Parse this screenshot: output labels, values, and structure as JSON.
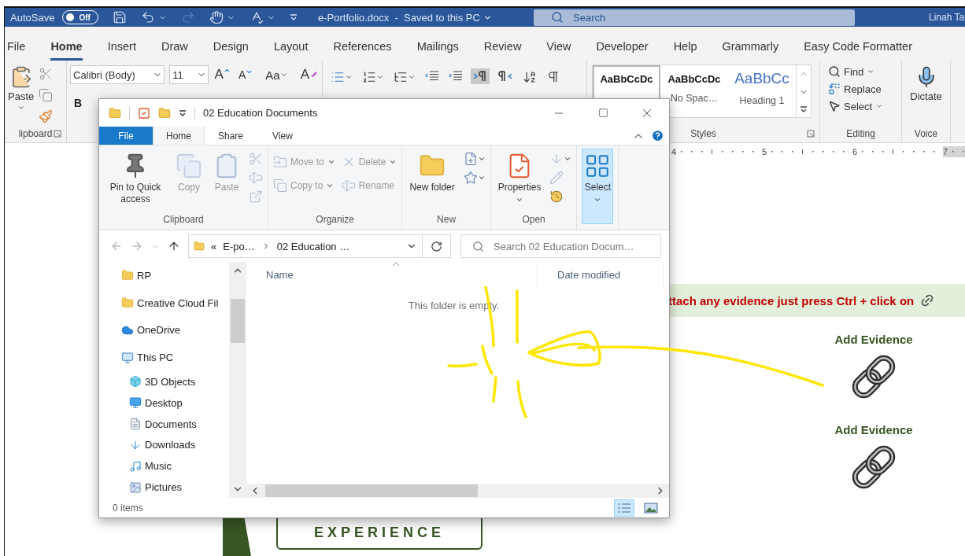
{
  "word": {
    "autosave": {
      "label": "AutoSave",
      "toggle": {
        "on": false,
        "label": "Off"
      }
    },
    "title": "e-Portfolio.docx  -  Saved to this PC",
    "search": {
      "placeholder": "Search"
    },
    "user": "Linah Ta",
    "tabs": [
      {
        "label": "File",
        "selected": false
      },
      {
        "label": "Home",
        "selected": true
      },
      {
        "label": "Insert",
        "selected": false
      },
      {
        "label": "Draw",
        "selected": false
      },
      {
        "label": "Design",
        "selected": false
      },
      {
        "label": "Layout",
        "selected": false
      },
      {
        "label": "References",
        "selected": false
      },
      {
        "label": "Mailings",
        "selected": false
      },
      {
        "label": "Review",
        "selected": false
      },
      {
        "label": "View",
        "selected": false
      },
      {
        "label": "Developer",
        "selected": false
      },
      {
        "label": "Help",
        "selected": false
      },
      {
        "label": "Grammarly",
        "selected": false
      },
      {
        "label": "Easy Code Formatter",
        "selected": false
      }
    ],
    "ribbon": {
      "clipboard": {
        "paste": "Paste",
        "label": "lipboard"
      },
      "font": {
        "name": "Calibri (Body)",
        "size": "11",
        "tools": [
          {
            "kind": "grow",
            "label": "A"
          },
          {
            "kind": "shrink",
            "label": "A"
          },
          {
            "kind": "case",
            "label": "Aa"
          },
          {
            "kind": "clear",
            "label": "A"
          }
        ],
        "bold": "B"
      },
      "paragraph": {
        "tools": [
          {
            "kind": "bullets",
            "selected": false
          },
          {
            "kind": "numbering",
            "selected": false
          },
          {
            "kind": "multilevel",
            "selected": false
          },
          {
            "kind": "outdent",
            "selected": false
          },
          {
            "kind": "indent",
            "selected": false
          },
          {
            "kind": "ltr",
            "selected": true
          },
          {
            "kind": "rtl",
            "selected": false
          },
          {
            "kind": "sort",
            "selected": false
          },
          {
            "kind": "marks",
            "selected": false
          }
        ]
      },
      "styles": {
        "label": "Styles",
        "items": [
          {
            "preview": "AaBbCcDc",
            "kind": "normal",
            "selected": true
          },
          {
            "preview": "AaBbCcDc",
            "name": "No Spac…",
            "kind": "normal",
            "selected": false
          },
          {
            "preview": "AaBbCc",
            "name": "Heading 1",
            "kind": "heading",
            "selected": false
          }
        ]
      },
      "editing": {
        "label": "Editing",
        "items": [
          {
            "kind": "find",
            "label": "Find"
          },
          {
            "kind": "replace",
            "label": "Replace"
          },
          {
            "kind": "select",
            "label": "Select"
          }
        ]
      },
      "voice": {
        "label": "Voice",
        "dictate": "Dictate"
      }
    },
    "ruler": [
      "4",
      "5",
      "6",
      "7"
    ],
    "document": {
      "banner": "ttach any evidence just press Ctrl + click on",
      "evidence": [
        {
          "label": "Add Evidence"
        },
        {
          "label": "Add Evidence"
        }
      ],
      "heading": "EXPERIENCE"
    }
  },
  "explorer": {
    "title": "02 Education Documents",
    "tabs": [
      {
        "label": "File",
        "kind": "file",
        "selected": false
      },
      {
        "label": "Home",
        "kind": "tab",
        "selected": true
      },
      {
        "label": "Share",
        "kind": "tab",
        "selected": false
      },
      {
        "label": "View",
        "kind": "tab",
        "selected": false
      }
    ],
    "ribbon": [
      {
        "label": "Clipboard",
        "items": [
          {
            "kind": "pin",
            "label": "Pin to Quick access",
            "disabled": false,
            "dropdown": false,
            "highlighted": false
          },
          {
            "kind": "copy",
            "label": "Copy",
            "disabled": true,
            "dropdown": false,
            "highlighted": false
          },
          {
            "kind": "paste",
            "label": "Paste",
            "disabled": true,
            "dropdown": false,
            "highlighted": false
          },
          {
            "kind": "cut",
            "disabled": true,
            "dropdown": false,
            "highlighted": false
          },
          {
            "kind": "copy-path",
            "disabled": true,
            "dropdown": false,
            "highlighted": false
          },
          {
            "kind": "paste-shortcut",
            "disabled": true,
            "dropdown": false,
            "highlighted": false
          }
        ]
      },
      {
        "label": "Organize",
        "items": [
          {
            "kind": "move",
            "label": "Move to",
            "disabled": true,
            "dropdown": true,
            "highlighted": false
          },
          {
            "kind": "copy-to",
            "label": "Copy to",
            "disabled": true,
            "dropdown": true,
            "highlighted": false
          },
          {
            "kind": "delete",
            "label": "Delete",
            "disabled": true,
            "dropdown": true,
            "highlighted": false
          },
          {
            "kind": "rename",
            "label": "Rename",
            "disabled": true,
            "dropdown": false,
            "highlighted": false
          }
        ]
      },
      {
        "label": "New",
        "items": [
          {
            "kind": "new-folder",
            "label": "New folder",
            "disabled": false,
            "dropdown": false,
            "highlighted": false
          },
          {
            "kind": "new-item",
            "disabled": false,
            "dropdown": true,
            "highlighted": false
          },
          {
            "kind": "easy-access",
            "disabled": false,
            "dropdown": true,
            "highlighted": false
          }
        ]
      },
      {
        "label": "Open",
        "items": [
          {
            "kind": "properties",
            "label": "Properties",
            "disabled": false,
            "dropdown": true,
            "highlighted": false
          },
          {
            "kind": "open",
            "disabled": true,
            "dropdown": true,
            "highlighted": false
          },
          {
            "kind": "edit",
            "disabled": true,
            "dropdown": false,
            "highlighted": false
          },
          {
            "kind": "history",
            "disabled": false,
            "dropdown": false,
            "highlighted": false
          }
        ]
      },
      {
        "items": [
          {
            "kind": "select",
            "label": "Select",
            "disabled": false,
            "dropdown": true,
            "highlighted": true
          }
        ]
      }
    ],
    "address": {
      "overflow": "«",
      "crumbs": [
        "E-po…",
        "02 Education …"
      ]
    },
    "search": {
      "placeholder": "Search 02 Education Docum…"
    },
    "nav": [
      {
        "label": "RP",
        "kind": "folder"
      },
      {
        "label": "Creative Cloud Fil",
        "kind": "cloud-files"
      },
      {
        "label": "OneDrive",
        "kind": "onedrive"
      },
      {
        "label": "This PC",
        "kind": "pc",
        "children": [
          {
            "label": "3D Objects",
            "kind": "objects"
          },
          {
            "label": "Desktop",
            "kind": "desktop"
          },
          {
            "label": "Documents",
            "kind": "documents"
          },
          {
            "label": "Downloads",
            "kind": "downloads"
          },
          {
            "label": "Music",
            "kind": "music"
          },
          {
            "label": "Pictures",
            "kind": "pictures"
          }
        ]
      }
    ],
    "columns": [
      {
        "label": "Name",
        "sorted": true
      },
      {
        "label": "Date modified",
        "sorted": false
      }
    ],
    "empty_message": "This folder is empty.",
    "status": "0 items",
    "views": [
      {
        "kind": "details",
        "selected": true
      },
      {
        "kind": "large-icons",
        "selected": false
      }
    ]
  }
}
